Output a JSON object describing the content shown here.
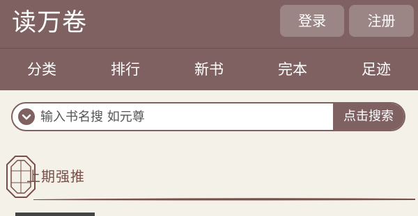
{
  "header": {
    "site_title": "读万卷",
    "login_label": "登录",
    "register_label": "注册"
  },
  "nav": {
    "items": [
      {
        "label": "分类"
      },
      {
        "label": "排行"
      },
      {
        "label": "新书"
      },
      {
        "label": "完本"
      },
      {
        "label": "足迹"
      }
    ]
  },
  "search": {
    "placeholder": "输入书名搜 如元尊",
    "button_label": "点击搜索",
    "toggle_icon": "chevron-down-icon"
  },
  "section": {
    "title": "上期强推"
  },
  "colors": {
    "brand": "#806161",
    "button_bg": "#9b8585",
    "page_bg": "#f4f1e8",
    "section_title": "#7a4e48"
  }
}
